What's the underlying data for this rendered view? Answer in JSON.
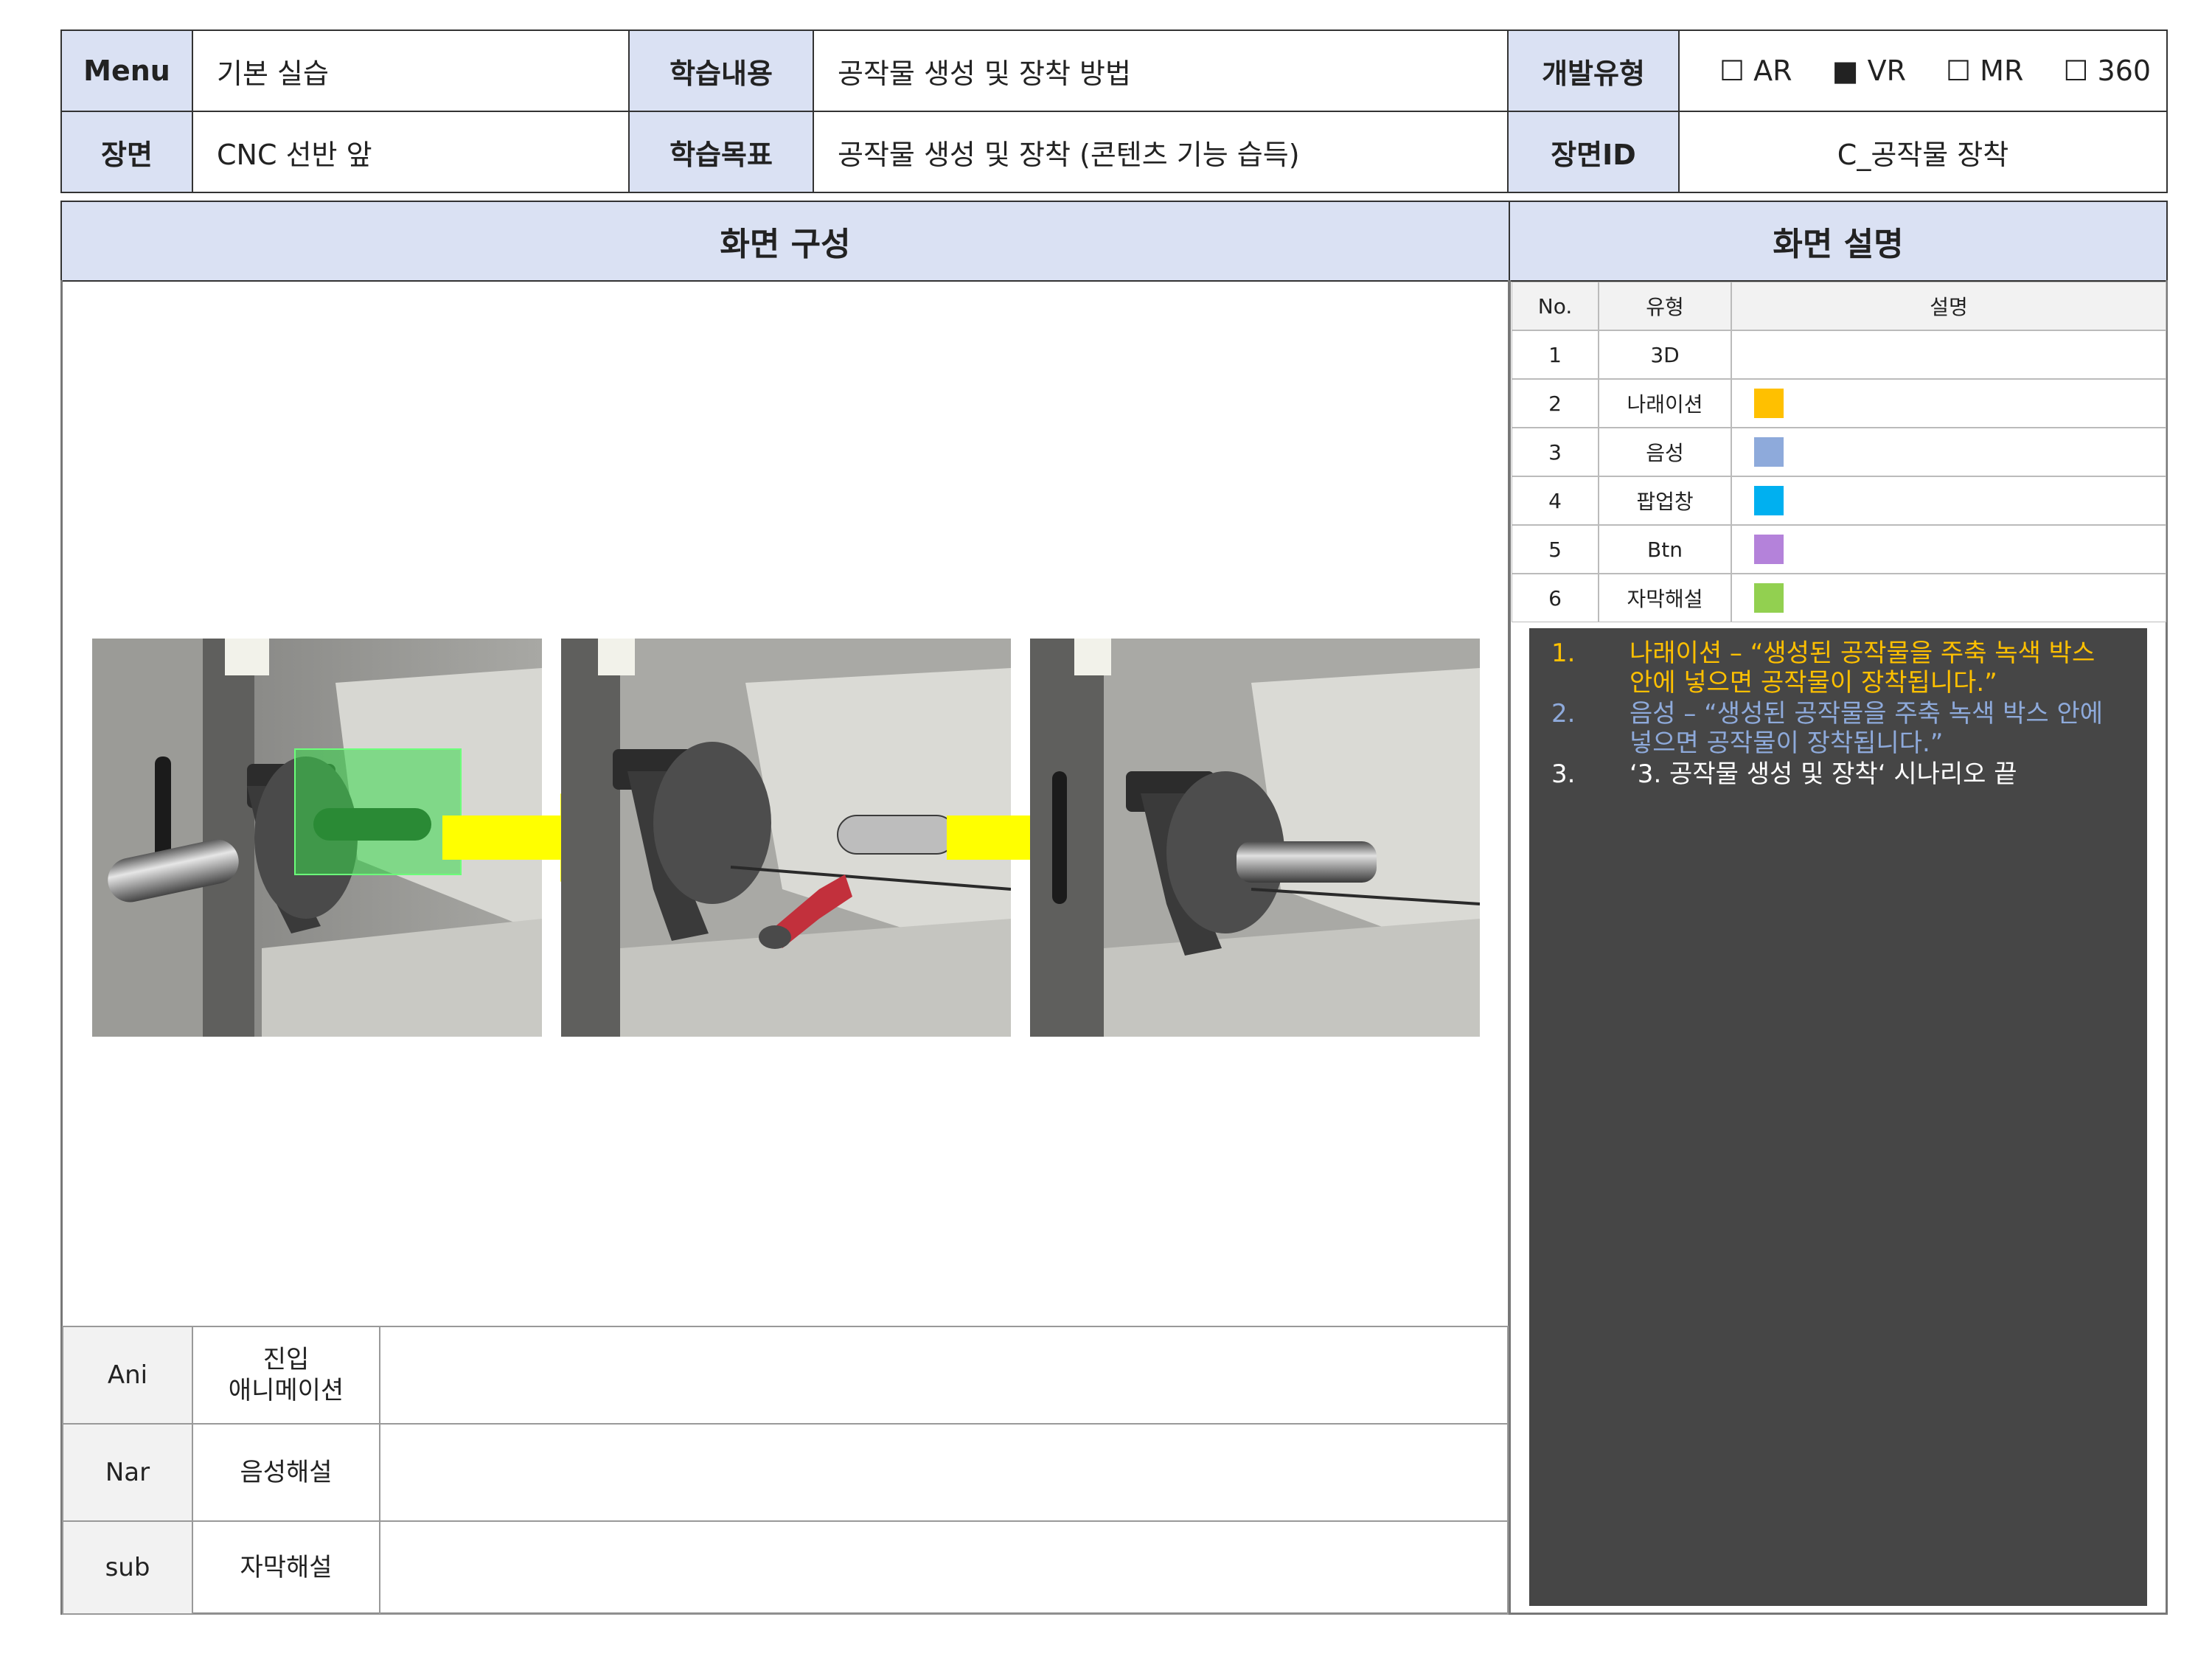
{
  "header": {
    "menu_label": "Menu",
    "menu_value": "기본 실습",
    "content_label": "학습내용",
    "content_value": "공작물 생성 및 장착 방법",
    "devtype_label": "개발유형",
    "devtype_options": [
      {
        "label": "AR",
        "checked": false
      },
      {
        "label": "VR",
        "checked": true
      },
      {
        "label": "MR",
        "checked": false
      },
      {
        "label": "360",
        "checked": false
      }
    ],
    "scene_label": "장면",
    "scene_value": "CNC 선반 앞",
    "goal_label": "학습목표",
    "goal_value": "공작물 생성 및 장착 (콘텐츠 기능 습득)",
    "sceneid_label": "장면ID",
    "sceneid_value": "C_공작물 장착",
    "unchecked_glyph": "☐",
    "checked_glyph": "■"
  },
  "sections": {
    "screen_title": "화면 구성",
    "desc_title": "화면 설명"
  },
  "legend": {
    "headers": [
      "No.",
      "유형",
      "설명"
    ],
    "rows": [
      {
        "no": "1",
        "type": "3D",
        "color": ""
      },
      {
        "no": "2",
        "type": "나래이션",
        "color": "#ffc000"
      },
      {
        "no": "3",
        "type": "음성",
        "color": "#8eaadb"
      },
      {
        "no": "4",
        "type": "팝업창",
        "color": "#00b0f0"
      },
      {
        "no": "5",
        "type": "Btn",
        "color": "#b482da"
      },
      {
        "no": "6",
        "type": "자막해설",
        "color": "#92d050"
      }
    ]
  },
  "description": {
    "items": [
      {
        "num": "1.",
        "line1": "나래이션 – “생성된 공작물을 주축 녹색 박스",
        "line2": "안에 넣으면 공작물이 장착됩니다.”",
        "color": "#ffc000"
      },
      {
        "num": "2.",
        "line1": "음성 – “생성된 공작물을 주축 녹색 박스 안에",
        "line2": "넣으면 공작물이 장착됩니다.”",
        "color": "#8eaadb"
      },
      {
        "num": "3.",
        "line1": "‘3. 공작물 생성 및 장착‘ 시나리오 끝",
        "line2": "",
        "color": "#ffffff"
      }
    ]
  },
  "bottom_table": {
    "rows": [
      {
        "code": "Ani",
        "label_line1": "진입",
        "label_line2": "애니메이션",
        "value": ""
      },
      {
        "code": "Nar",
        "label_line1": "음성해설",
        "label_line2": "",
        "value": ""
      },
      {
        "code": "sub",
        "label_line1": "자막해설",
        "label_line2": "",
        "value": ""
      }
    ]
  },
  "colors": {
    "header_bg": "#dae1f3",
    "arrow": "#ffff00",
    "green_box": "#39d84a",
    "panel_bg": "#464646"
  }
}
